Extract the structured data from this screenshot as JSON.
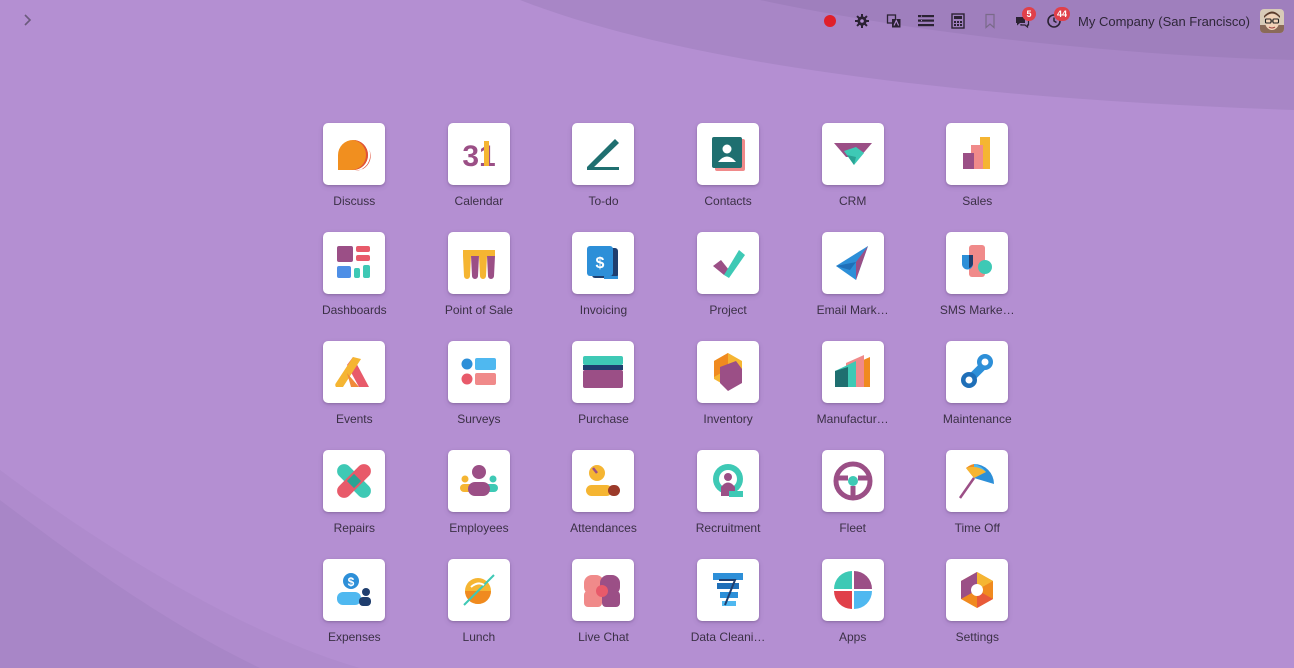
{
  "company": "My Company (San Francisco)",
  "systray": {
    "messages_count": "5",
    "activities_count": "44"
  },
  "apps": [
    {
      "name": "Discuss",
      "icon": "discuss-icon"
    },
    {
      "name": "Calendar",
      "icon": "calendar-icon",
      "icon_text": "31"
    },
    {
      "name": "To-do",
      "icon": "todo-icon"
    },
    {
      "name": "Contacts",
      "icon": "contacts-icon"
    },
    {
      "name": "CRM",
      "icon": "crm-icon"
    },
    {
      "name": "Sales",
      "icon": "sales-icon"
    },
    {
      "name": "Dashboards",
      "icon": "dashboards-icon"
    },
    {
      "name": "Point of Sale",
      "icon": "point-of-sale-icon"
    },
    {
      "name": "Invoicing",
      "icon": "invoicing-icon",
      "icon_text": "$"
    },
    {
      "name": "Project",
      "icon": "project-icon"
    },
    {
      "name": "Email Mark…",
      "icon": "email-marketing-icon"
    },
    {
      "name": "SMS Marke…",
      "icon": "sms-marketing-icon"
    },
    {
      "name": "Events",
      "icon": "events-icon"
    },
    {
      "name": "Surveys",
      "icon": "surveys-icon"
    },
    {
      "name": "Purchase",
      "icon": "purchase-icon"
    },
    {
      "name": "Inventory",
      "icon": "inventory-icon"
    },
    {
      "name": "Manufactur…",
      "icon": "manufacturing-icon"
    },
    {
      "name": "Maintenance",
      "icon": "maintenance-icon"
    },
    {
      "name": "Repairs",
      "icon": "repairs-icon"
    },
    {
      "name": "Employees",
      "icon": "employees-icon"
    },
    {
      "name": "Attendances",
      "icon": "attendances-icon"
    },
    {
      "name": "Recruitment",
      "icon": "recruitment-icon"
    },
    {
      "name": "Fleet",
      "icon": "fleet-icon"
    },
    {
      "name": "Time Off",
      "icon": "time-off-icon"
    },
    {
      "name": "Expenses",
      "icon": "expenses-icon",
      "icon_text": "$"
    },
    {
      "name": "Lunch",
      "icon": "lunch-icon"
    },
    {
      "name": "Live Chat",
      "icon": "live-chat-icon"
    },
    {
      "name": "Data Cleani…",
      "icon": "data-cleaning-icon"
    },
    {
      "name": "Apps",
      "icon": "apps-icon"
    },
    {
      "name": "Settings",
      "icon": "settings-icon"
    }
  ],
  "colors": {
    "background": "#b48fd2",
    "badge": "#e0404a",
    "record": "#e0202a"
  }
}
